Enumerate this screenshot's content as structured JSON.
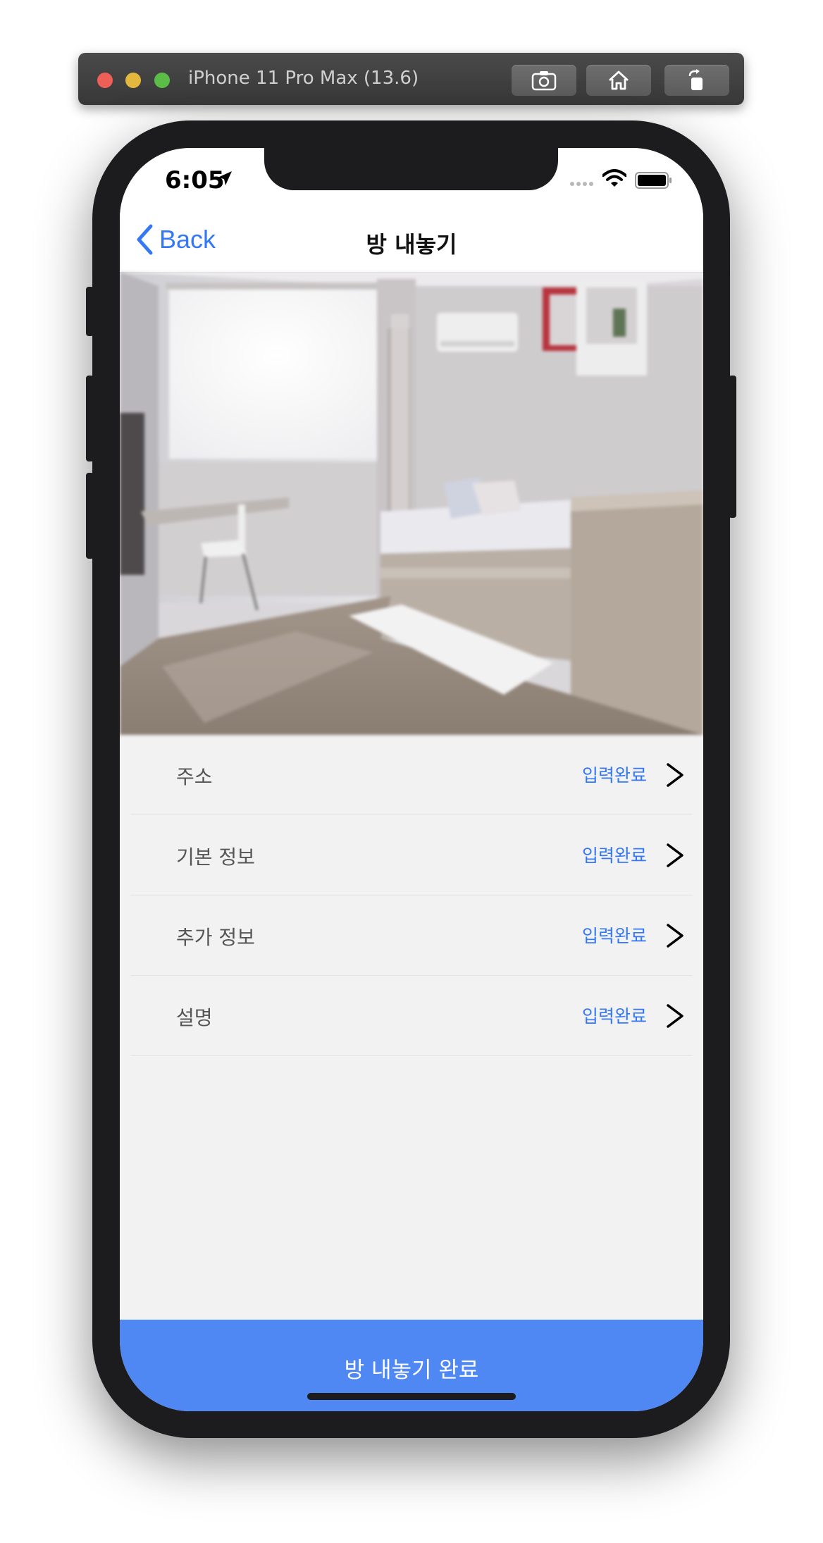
{
  "simulator": {
    "title": "iPhone 11 Pro Max (13.6)",
    "buttons": [
      "screenshot-icon",
      "home-icon",
      "rotate-icon"
    ]
  },
  "status_bar": {
    "time": "6:05"
  },
  "nav": {
    "back_label": "Back",
    "title": "방 내놓기"
  },
  "rows": [
    {
      "label": "주소",
      "status": "입력완료"
    },
    {
      "label": "기본 정보",
      "status": "입력완료"
    },
    {
      "label": "추가 정보",
      "status": "입력완료"
    },
    {
      "label": "설명",
      "status": "입력완료"
    }
  ],
  "cta": {
    "label": "방 내놓기 완료"
  },
  "colors": {
    "accent": "#3478f6",
    "cta_background": "#4f87f3",
    "background": "#f2f2f2"
  }
}
